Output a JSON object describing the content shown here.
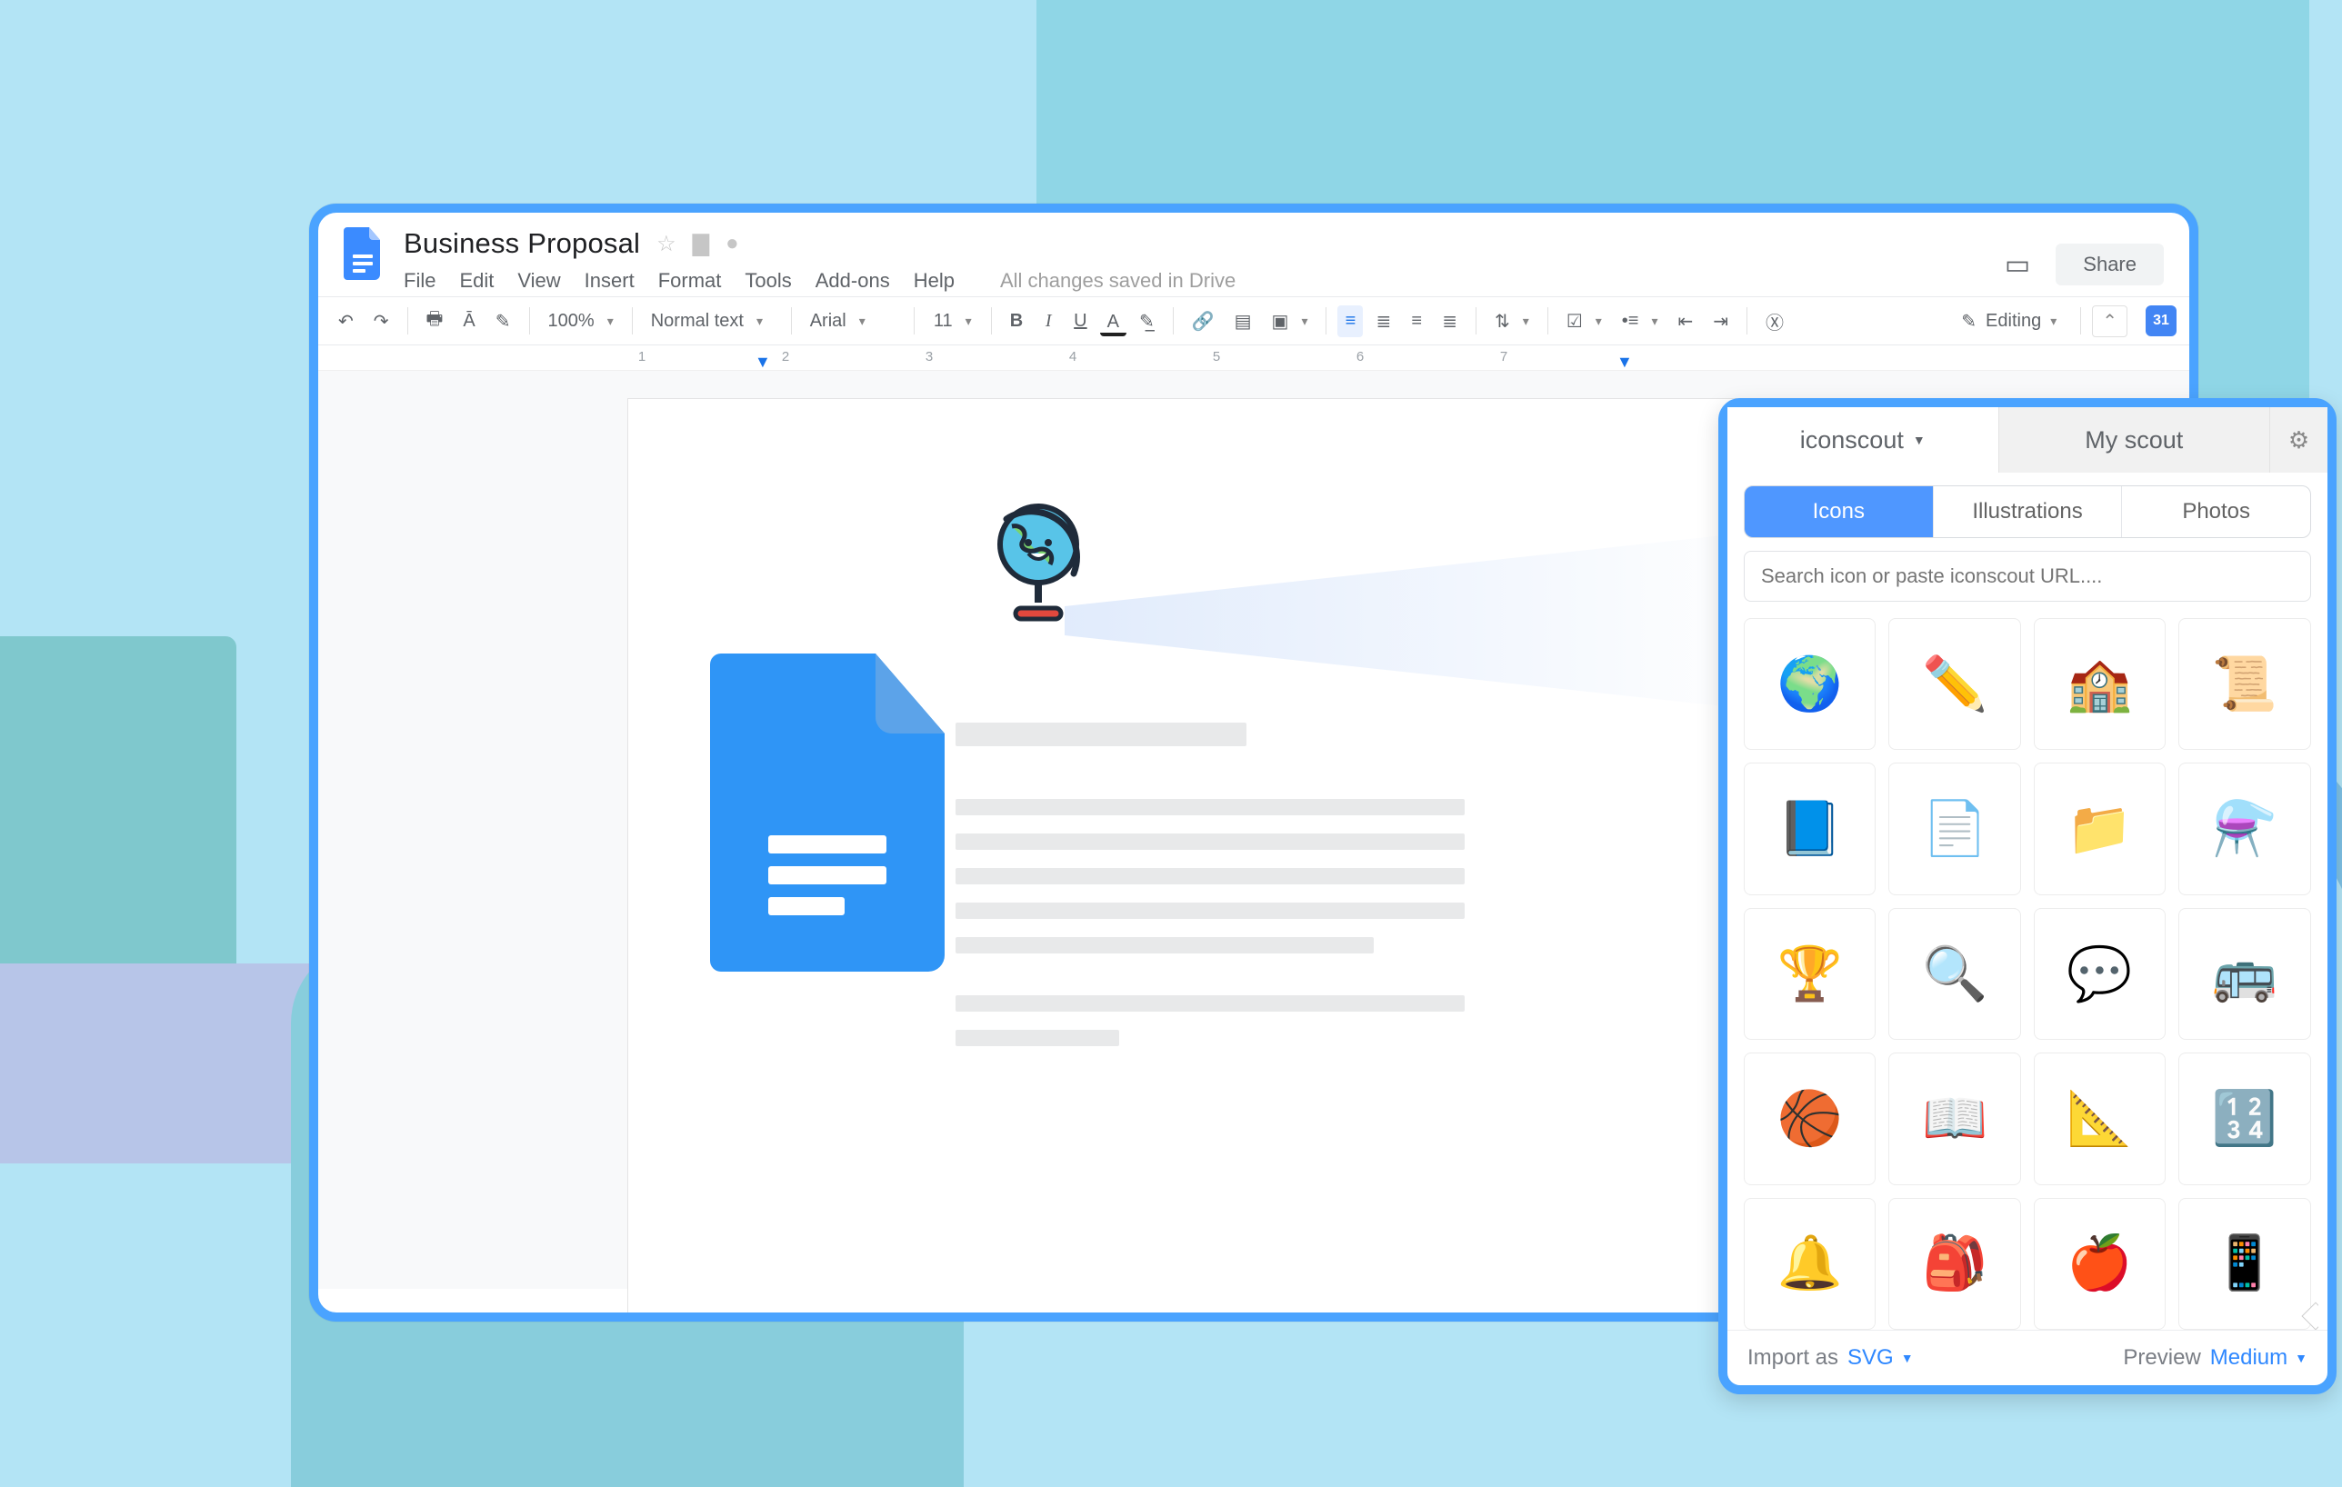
{
  "doc": {
    "title": "Business Proposal",
    "status": "All changes saved in Drive",
    "share_label": "Share",
    "menus": [
      "File",
      "Edit",
      "View",
      "Insert",
      "Format",
      "Tools",
      "Add-ons",
      "Help"
    ]
  },
  "toolbar": {
    "zoom": "100%",
    "style": "Normal text",
    "font": "Arial",
    "size": "11",
    "mode_label": "Editing",
    "calendar_day": "31"
  },
  "ruler": {
    "numbers": [
      "1",
      "2",
      "3",
      "4",
      "5",
      "6",
      "7"
    ]
  },
  "scout": {
    "tab_main": "iconscout",
    "tab_secondary": "My scout",
    "pills": {
      "icons": "Icons",
      "illustrations": "Illustrations",
      "photos": "Photos"
    },
    "search_placeholder": "Search icon or paste iconscout URL....",
    "import_label": "Import as",
    "import_value": "SVG",
    "preview_label": "Preview",
    "preview_value": "Medium",
    "icons": [
      {
        "name": "globe-icon",
        "glyph": "🌍"
      },
      {
        "name": "pencil-icon",
        "glyph": "✏️"
      },
      {
        "name": "school-icon",
        "glyph": "🏫"
      },
      {
        "name": "scroll-icon",
        "glyph": "📜"
      },
      {
        "name": "notebook-icon",
        "glyph": "📘"
      },
      {
        "name": "test-paper-icon",
        "glyph": "📄"
      },
      {
        "name": "folder-icon",
        "glyph": "📁"
      },
      {
        "name": "flask-icon",
        "glyph": "⚗️"
      },
      {
        "name": "trophy-icon",
        "glyph": "🏆"
      },
      {
        "name": "magnifier-icon",
        "glyph": "🔍"
      },
      {
        "name": "chat-bubbles-icon",
        "glyph": "💬"
      },
      {
        "name": "bus-icon",
        "glyph": "🚌"
      },
      {
        "name": "basketball-icon",
        "glyph": "🏀"
      },
      {
        "name": "book-open-icon",
        "glyph": "📖"
      },
      {
        "name": "protractor-icon",
        "glyph": "📐"
      },
      {
        "name": "chalkboard-icon",
        "glyph": "🔢"
      },
      {
        "name": "bell-icon",
        "glyph": "🔔"
      },
      {
        "name": "backpack-icon",
        "glyph": "🎒"
      },
      {
        "name": "apple-icon",
        "glyph": "🍎"
      },
      {
        "name": "calculator-icon",
        "glyph": "📱"
      }
    ]
  },
  "colors": {
    "accent": "#4aa3ff",
    "link": "#2f88ff"
  }
}
